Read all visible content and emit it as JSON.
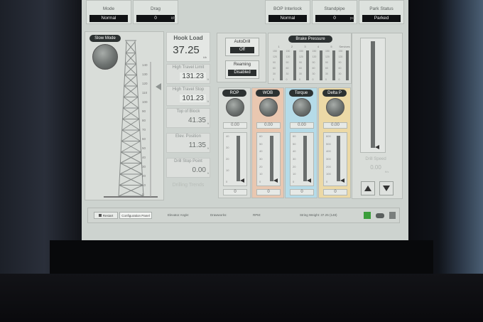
{
  "header": {
    "mode": {
      "label": "Mode",
      "value": "Normal"
    },
    "drag": {
      "label": "Drag",
      "value": "0",
      "unit": "klb"
    },
    "bop_interlock": {
      "label": "BOP Interlock",
      "value": "Normal"
    },
    "standpipe": {
      "label": "Standpipe",
      "value": "0",
      "unit": "psi"
    },
    "park_status": {
      "label": "Park Status",
      "value": "Parked"
    }
  },
  "slow_mode": {
    "label": "Slow Mode"
  },
  "derrick": {
    "scale": [
      "140",
      "130",
      "120",
      "110",
      "100",
      "90",
      "80",
      "70",
      "60",
      "50",
      "40",
      "30",
      "20",
      "10",
      "0"
    ]
  },
  "hook_load": {
    "label": "Hook Load",
    "value": "37.25",
    "unit": "klb"
  },
  "high_travel_limit": {
    "label": "High Travel Limit",
    "value": "131.23",
    "unit": "ft"
  },
  "high_travel_stop": {
    "label": "High Travel Stop",
    "value": "101.23",
    "unit": "ft"
  },
  "top_of_block": {
    "label": "Top of Block",
    "value": "41.35",
    "unit": "ft"
  },
  "elev_position": {
    "label": "Elev. Position",
    "value": "11.35",
    "unit": "ft"
  },
  "drill_stop_point": {
    "label": "Drill Stop Point",
    "value": "0.00",
    "unit": "ft"
  },
  "drilling_trends": {
    "label": "Drilling Trends"
  },
  "autodrill": {
    "label": "AutoDrill",
    "value": "Off"
  },
  "reaming": {
    "label": "Reaming",
    "value": "Disabled"
  },
  "brake_pressure": {
    "label": "Brake Pressure",
    "scale": [
      "150",
      "120",
      "90",
      "60",
      "30",
      "0"
    ],
    "labels": [
      "1",
      "2",
      "3",
      "4",
      "5",
      "Services"
    ]
  },
  "gauges": [
    {
      "name": "ROP",
      "value": "0.00",
      "color": "#d9ddd9",
      "scale": [
        "40",
        "30",
        "20",
        "10",
        "0"
      ],
      "bottom_value": "0"
    },
    {
      "name": "WOB",
      "value": "0.00",
      "color": "#e9c7b0",
      "scale": [
        "60",
        "50",
        "40",
        "30",
        "20",
        "10",
        "0"
      ],
      "bottom_value": "0"
    },
    {
      "name": "Torque",
      "value": "0.00",
      "color": "#b5dbe8",
      "scale": [
        "60",
        "50",
        "40",
        "30",
        "20",
        "10",
        "0"
      ],
      "bottom_value": "0"
    },
    {
      "name": "Delta P",
      "value": "0.00",
      "color": "#ecd9a6",
      "scale": [
        "600",
        "500",
        "400",
        "300",
        "200",
        "100",
        "0"
      ],
      "bottom_value": "0"
    }
  ],
  "drill_speed": {
    "label": "Drill Speed",
    "value": "0.00",
    "unit": "ft/s"
  },
  "status_bar": {
    "restart": "Restart",
    "config": "Configuration Panel",
    "elevator_angle": "Elevator Angle:",
    "drawworks": "Drawworks:",
    "rpm": "RPM:",
    "string_weight": "String Weight: 37.25 (148)"
  }
}
